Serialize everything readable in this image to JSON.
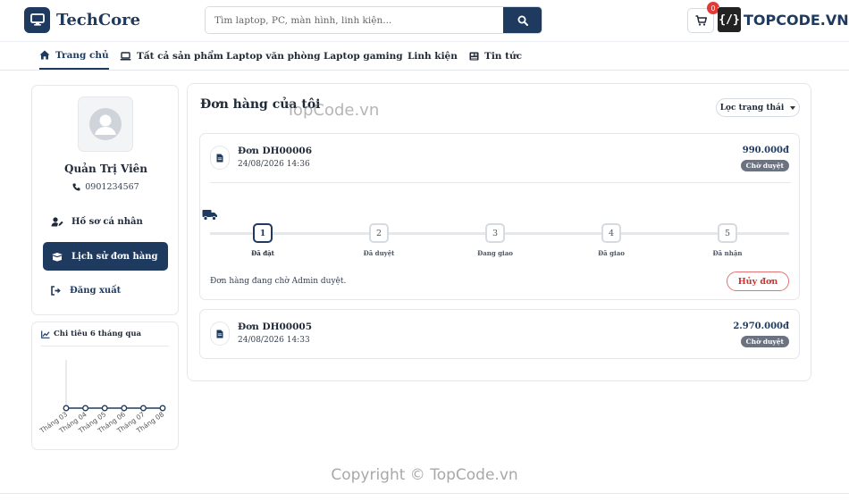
{
  "header": {
    "logo_text": "TechCore",
    "search_placeholder": "Tìm laptop, PC, màn hình, linh kiện...",
    "cart_count": "0",
    "watermark_brand": "TOPCODE.VN",
    "watermark_mark": "{/}"
  },
  "nav": {
    "items": [
      {
        "label": "Trang chủ",
        "icon": "home-icon",
        "active": true
      },
      {
        "label": "Tất cả sản phẩm",
        "icon": "laptop-icon"
      },
      {
        "label": "Laptop văn phòng"
      },
      {
        "label": "Laptop gaming"
      },
      {
        "label": "Linh kiện"
      },
      {
        "label": "Tin tức",
        "icon": "newspaper-icon"
      }
    ]
  },
  "profile": {
    "name": "Quản Trị Viên",
    "phone": "0901234567",
    "menu": [
      {
        "label": "Hồ sơ cá nhân",
        "icon": "user-edit-icon"
      },
      {
        "label": "Lịch sử đơn hàng",
        "icon": "box-open-icon",
        "active": true
      },
      {
        "label": "Đăng xuất",
        "icon": "sign-out-icon"
      }
    ]
  },
  "chart_data": {
    "type": "line",
    "title": "Chi tiêu 6 tháng qua",
    "categories": [
      "Tháng 03",
      "Tháng 04",
      "Tháng 05",
      "Tháng 06",
      "Tháng 07",
      "Tháng 08"
    ],
    "values": [
      0,
      0,
      0,
      0,
      0,
      0
    ],
    "ylim": [
      0,
      1
    ],
    "color": "#1e3a5f"
  },
  "main": {
    "title": "Đơn hàng của tôi",
    "filter_label": "Lọc trạng thái",
    "steps": [
      "Đã đặt",
      "Đã duyệt",
      "Đang giao",
      "Đã giao",
      "Đã nhận"
    ],
    "orders": [
      {
        "code": "Đơn DH00006",
        "date": "24/08/2026 14:36",
        "total": "990.000đ",
        "status": "Chờ duyệt",
        "current_step": 1,
        "note": "Đơn hàng đang chờ Admin duyệt.",
        "cancel_label": "Hủy đơn"
      },
      {
        "code": "Đơn DH00005",
        "date": "24/08/2026 14:33",
        "total": "2.970.000đ",
        "status": "Chờ duyệt"
      }
    ]
  },
  "watermarks": {
    "center": "TopCode.vn",
    "copyright": "Copyright © TopCode.vn"
  },
  "colors": {
    "primary": "#1e3a5f",
    "danger": "#d32f2f",
    "badge_gray": "#6b7280"
  }
}
